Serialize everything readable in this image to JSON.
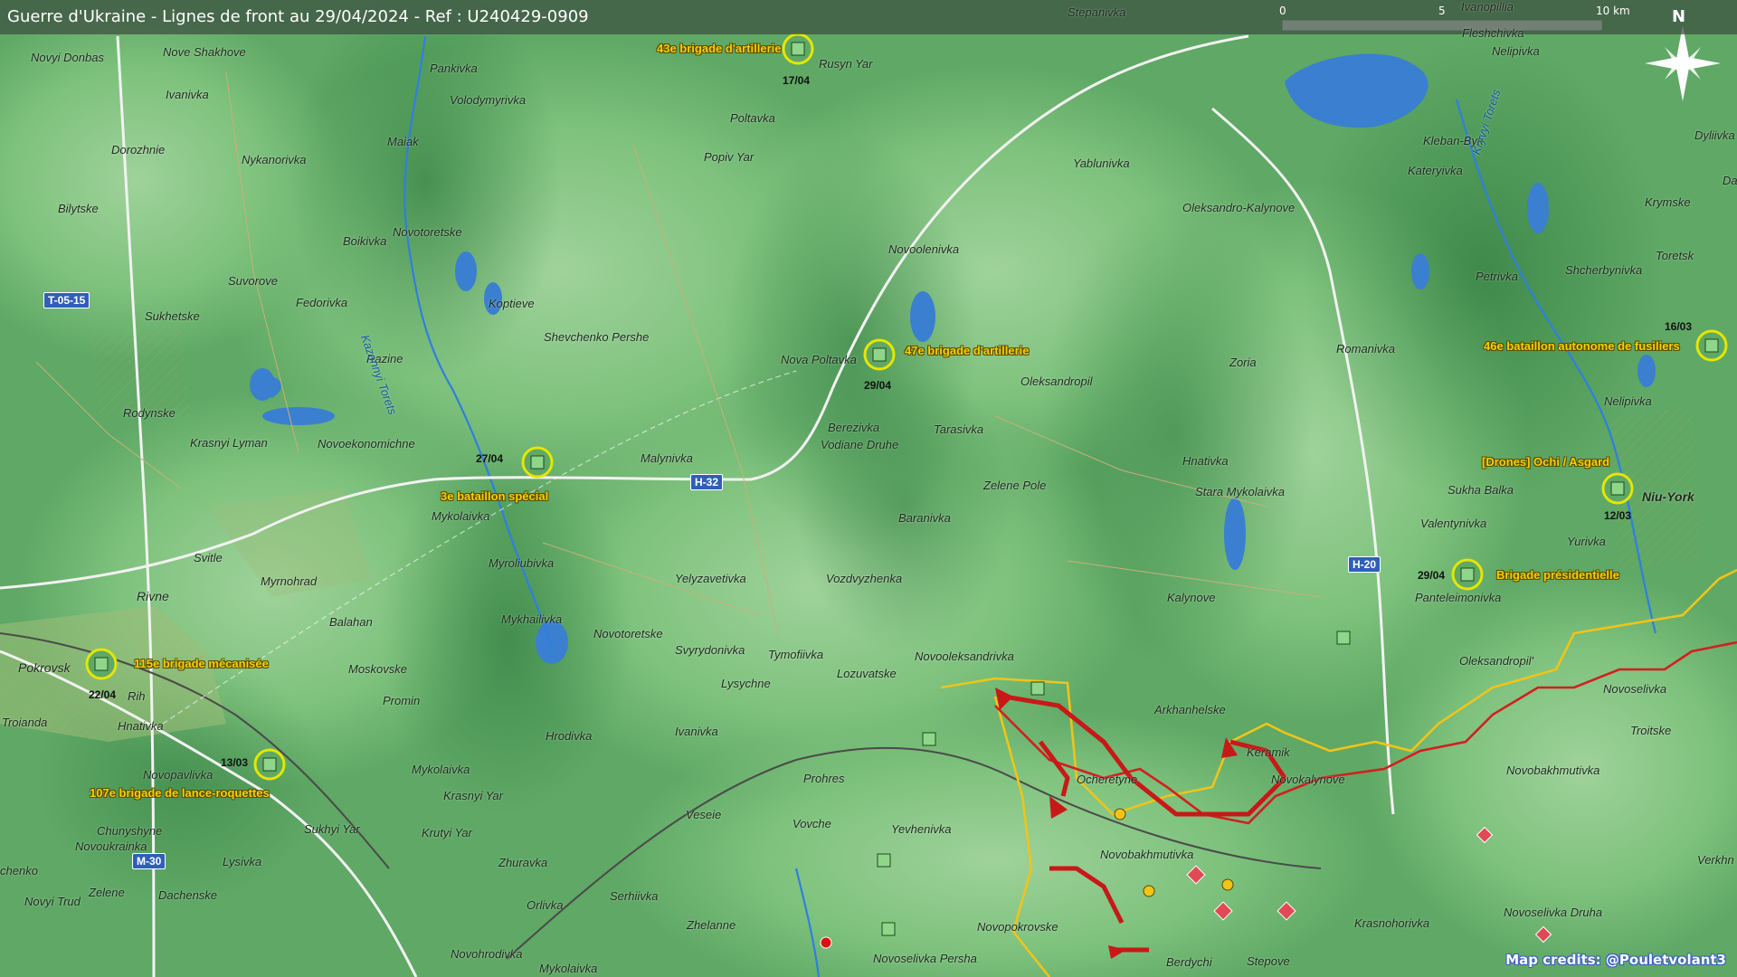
{
  "title": "Guerre d'Ukraine - Lignes de front au 29/04/2024 - Ref : U240429-0909",
  "credits": "Map credits: @Pouletvolant3",
  "scale": {
    "zero": "0",
    "mid": "5",
    "max": "10 km"
  },
  "north": "N",
  "colors": {
    "ukrainian_line": "#f0c419",
    "russian_line": "#d02020",
    "unit_marker": "#e6e600",
    "land": "#5fa865",
    "water": "#3a7fd0"
  },
  "places": [
    {
      "id": "novyi-donbas",
      "name": "Novyi Donbas"
    },
    {
      "id": "nove-shakhove",
      "name": "Nove Shakhove"
    },
    {
      "id": "pankivka",
      "name": "Pankivka"
    },
    {
      "id": "stepanivka",
      "name": "Stepanivka"
    },
    {
      "id": "rusyn-yar",
      "name": "Rusyn Yar"
    },
    {
      "id": "ivanivka-1",
      "name": "Ivanivka"
    },
    {
      "id": "volodymyrivka",
      "name": "Volodymyrivka"
    },
    {
      "id": "poltavka",
      "name": "Poltavka"
    },
    {
      "id": "maiak",
      "name": "Maiak"
    },
    {
      "id": "dorozhnie",
      "name": "Dorozhnie"
    },
    {
      "id": "nykanorivka",
      "name": "Nykanorivka"
    },
    {
      "id": "popiv-yar",
      "name": "Popiv Yar"
    },
    {
      "id": "yablunivka",
      "name": "Yablunivka"
    },
    {
      "id": "kleban-byk",
      "name": "Kleban-Byk"
    },
    {
      "id": "kateryivka",
      "name": "Kateryivka"
    },
    {
      "id": "bilytske",
      "name": "Bilytske"
    },
    {
      "id": "novotoretske-1",
      "name": "Novotoretske"
    },
    {
      "id": "boikivka",
      "name": "Boikivka"
    },
    {
      "id": "oleksandro-kalynove",
      "name": "Oleksandro-Kalynove"
    },
    {
      "id": "krymske",
      "name": "Krymske"
    },
    {
      "id": "novoolenivka",
      "name": "Novoolenivka"
    },
    {
      "id": "suvorove",
      "name": "Suvorove"
    },
    {
      "id": "fedorivka",
      "name": "Fedorivka"
    },
    {
      "id": "koptieve",
      "name": "Koptieve"
    },
    {
      "id": "toretsk",
      "name": "Toretsk"
    },
    {
      "id": "petrivka",
      "name": "Petrivka"
    },
    {
      "id": "shcherbynivka",
      "name": "Shcherbynivka"
    },
    {
      "id": "sukhetske",
      "name": "Sukhetske"
    },
    {
      "id": "shevchenko-pershe",
      "name": "Shevchenko Pershe"
    },
    {
      "id": "razine",
      "name": "Razine"
    },
    {
      "id": "nova-poltavka",
      "name": "Nova Poltavka"
    },
    {
      "id": "zoria",
      "name": "Zoria"
    },
    {
      "id": "romanivka",
      "name": "Romanivka"
    },
    {
      "id": "oleksandropil",
      "name": "Oleksandropil"
    },
    {
      "id": "rodynske",
      "name": "Rodynske"
    },
    {
      "id": "nelipivka-2",
      "name": "Nelipivka"
    },
    {
      "id": "krasnyi-lyman",
      "name": "Krasnyi Lyman"
    },
    {
      "id": "berezivka",
      "name": "Berezivka"
    },
    {
      "id": "tarasivka",
      "name": "Tarasivka"
    },
    {
      "id": "novoekonomichne",
      "name": "Novoekonomichne"
    },
    {
      "id": "vodiane-druhe",
      "name": "Vodiane Druhe"
    },
    {
      "id": "malynivka",
      "name": "Malynivka"
    },
    {
      "id": "hnativka",
      "name": "Hnativka"
    },
    {
      "id": "zelene-pole",
      "name": "Zelene Pole"
    },
    {
      "id": "stara-mykolaivka",
      "name": "Stara Mykolaivka"
    },
    {
      "id": "sukha-balka",
      "name": "Sukha Balka"
    },
    {
      "id": "niu-york",
      "name": "Niu-York"
    },
    {
      "id": "mykolaivka-1",
      "name": "Mykolaivka"
    },
    {
      "id": "baranivka",
      "name": "Baranivka"
    },
    {
      "id": "valentynivka",
      "name": "Valentynivka"
    },
    {
      "id": "yurivka",
      "name": "Yurivka"
    },
    {
      "id": "svitle",
      "name": "Svitle"
    },
    {
      "id": "myroliubivka",
      "name": "Myroliubivka"
    },
    {
      "id": "myrnohrad",
      "name": "Myrnohrad"
    },
    {
      "id": "yelyzavetivka",
      "name": "Yelyzavetivka"
    },
    {
      "id": "vozdvyzhenka",
      "name": "Vozdvyzhenka"
    },
    {
      "id": "rivne",
      "name": "Rivne"
    },
    {
      "id": "panteleimonivka",
      "name": "Panteleimonivka"
    },
    {
      "id": "kalynove",
      "name": "Kalynove"
    },
    {
      "id": "mykhailivka",
      "name": "Mykhailivka"
    },
    {
      "id": "balahan",
      "name": "Balahan"
    },
    {
      "id": "novotoretske-2",
      "name": "Novotoretske"
    },
    {
      "id": "svyrydonivka",
      "name": "Svyrydonivka"
    },
    {
      "id": "tymofiivka",
      "name": "Tymofiivka"
    },
    {
      "id": "novooleksandrivka",
      "name": "Novooleksandrivka"
    },
    {
      "id": "pokrovsk",
      "name": "Pokrovsk"
    },
    {
      "id": "moskovske",
      "name": "Moskovske"
    },
    {
      "id": "oleksandropil-2",
      "name": "Oleksandropil'"
    },
    {
      "id": "lozuvatske",
      "name": "Lozuvatske"
    },
    {
      "id": "lysychne",
      "name": "Lysychne"
    },
    {
      "id": "novoselivka",
      "name": "Novoselivka"
    },
    {
      "id": "promin",
      "name": "Promin"
    },
    {
      "id": "rih",
      "name": "Rih"
    },
    {
      "id": "troitske",
      "name": "Troitske"
    },
    {
      "id": "arkhanhelske",
      "name": "Arkhanhelske"
    },
    {
      "id": "troianda",
      "name": "Troianda"
    },
    {
      "id": "hnativka-2",
      "name": "Hnativka"
    },
    {
      "id": "ivanivka-2",
      "name": "Ivanivka"
    },
    {
      "id": "hrodivka",
      "name": "Hrodivka"
    },
    {
      "id": "keramik",
      "name": "Keramik"
    },
    {
      "id": "novopavlivka",
      "name": "Novopavlivka"
    },
    {
      "id": "mykolaivka-2",
      "name": "Mykolaivka"
    },
    {
      "id": "prohres",
      "name": "Prohres"
    },
    {
      "id": "ocheretyne",
      "name": "Ocheretyne"
    },
    {
      "id": "novokalynove",
      "name": "Novokalynove"
    },
    {
      "id": "novobakhmutivka-1",
      "name": "Novobakhmutivka"
    },
    {
      "id": "krasnyi-yar",
      "name": "Krasnyi Yar"
    },
    {
      "id": "veseie",
      "name": "Veseie"
    },
    {
      "id": "vovche",
      "name": "Vovche"
    },
    {
      "id": "yevhenivka",
      "name": "Yevhenivka"
    },
    {
      "id": "chunyshyne",
      "name": "Chunyshyne"
    },
    {
      "id": "sukhyi-yar",
      "name": "Sukhyi Yar"
    },
    {
      "id": "krutyi-yar",
      "name": "Krutyi Yar"
    },
    {
      "id": "novoukrainka",
      "name": "Novoukrainka"
    },
    {
      "id": "novobakhmutivka-2",
      "name": "Novobakhmutivka"
    },
    {
      "id": "lysivka",
      "name": "Lysivka"
    },
    {
      "id": "zhuravka",
      "name": "Zhuravka"
    },
    {
      "id": "verkhn",
      "name": "Verkhn"
    },
    {
      "id": "chenko",
      "name": "chenko"
    },
    {
      "id": "zelene",
      "name": "Zelene"
    },
    {
      "id": "dachenske",
      "name": "Dachenske"
    },
    {
      "id": "serhiivka",
      "name": "Serhiivka"
    },
    {
      "id": "novyi-trud",
      "name": "Novyi Trud"
    },
    {
      "id": "orlivka",
      "name": "Orlivka"
    },
    {
      "id": "novoselivka-druha",
      "name": "Novoselivka Druha"
    },
    {
      "id": "zhelanne",
      "name": "Zhelanne"
    },
    {
      "id": "novopokrovske",
      "name": "Novopokrovske"
    },
    {
      "id": "krasnohorivka",
      "name": "Krasnohorivka"
    },
    {
      "id": "novohrodivka",
      "name": "Novohrodivka"
    },
    {
      "id": "novoselivka-persha",
      "name": "Novoselivka Persha"
    },
    {
      "id": "berdychi",
      "name": "Berdychi"
    },
    {
      "id": "stepove",
      "name": "Stepove"
    },
    {
      "id": "mykolaivka-3",
      "name": "Mykolaivka"
    },
    {
      "id": "fleshchivka",
      "name": "Fleshchivka"
    },
    {
      "id": "nelipivka-1",
      "name": "Nelipivka"
    },
    {
      "id": "ivanopillia",
      "name": "Ivanopillia"
    },
    {
      "id": "dyliivka",
      "name": "Dyliivka"
    },
    {
      "id": "da",
      "name": "Da"
    }
  ],
  "rivers": [
    {
      "id": "kazennyi-torets",
      "name": "Kazennyi Torets"
    },
    {
      "id": "kryvyi-torets",
      "name": "Kryvyi Torets"
    }
  ],
  "roads": [
    {
      "id": "t-05-15",
      "label": "T-05-15"
    },
    {
      "id": "h-32",
      "label": "H-32"
    },
    {
      "id": "h-20",
      "label": "H-20"
    },
    {
      "id": "m-30",
      "label": "M-30"
    }
  ],
  "units": [
    {
      "id": "43-artillery",
      "label": "43e brigade d'artillerie",
      "date": "17/04"
    },
    {
      "id": "47-artillery",
      "label": "47e brigade d'artillerie",
      "date": "29/04"
    },
    {
      "id": "3-special-battalion",
      "label": "3e bataillon spécial",
      "date": "27/04"
    },
    {
      "id": "46-rifle-battalion",
      "label": "46e bataillon autonome de fusiliers",
      "date": "16/03"
    },
    {
      "id": "drones-ochi",
      "label": "[Drones] Ochi / Asgard",
      "date": "12/03"
    },
    {
      "id": "presidential-brigade",
      "label": "Brigade présidentielle",
      "date": "29/04"
    },
    {
      "id": "115-mechanized",
      "label": "115e brigade mécanisée",
      "date": "22/04"
    },
    {
      "id": "107-rocket",
      "label": "107e brigade de lance-roquettes",
      "date": "13/03"
    }
  ]
}
